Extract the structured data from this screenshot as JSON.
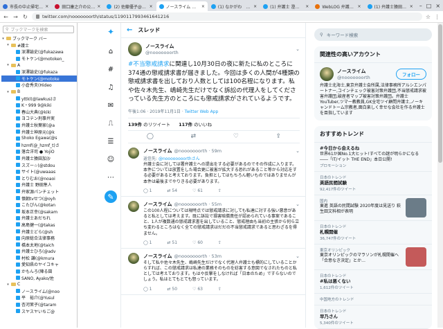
{
  "tabs": [
    {
      "label": "市長の中止帰宅でおれ…",
      "color": "#2e6fd8"
    },
    {
      "label": "田口康之介の公式ブログ",
      "color": "#c8102e"
    },
    {
      "label": "(2) 佐藤優子@ウィ…",
      "color": "#1da1f2"
    },
    {
      "label": "ノースライム さんはTwit…",
      "color": "#1da1f2",
      "active": true
    },
    {
      "label": "(1) なかがわ　もっ…",
      "color": "#1da1f2"
    },
    {
      "label": "(1) 弁護士 澄川 雄…",
      "color": "#1da1f2"
    },
    {
      "label": "WebLOG 弁護士…",
      "color": "#e8710a"
    },
    {
      "label": "(1) 弁護士猿田加…",
      "color": "#1da1f2"
    }
  ],
  "url": "twitter.com/nooooooorth/status/1190117993461641216",
  "sidebar": {
    "search_placeholder": "ブックマークを検索",
    "items": [
      {
        "label": "ブックマーク バー",
        "level": 0,
        "type": "folder",
        "expand": "▾"
      },
      {
        "label": "#護士",
        "level": 1,
        "type": "folder",
        "expand": "▾"
      },
      {
        "label": "深澤諭史(@fukazawa",
        "level": 2,
        "type": "bm"
      },
      {
        "label": "モトケン(@motoken_",
        "level": 2,
        "type": "bm"
      },
      {
        "label": "A",
        "level": 1,
        "type": "folder",
        "expand": "▾"
      },
      {
        "label": "深澤諭史(@fukaza",
        "level": 2,
        "type": "bm"
      },
      {
        "label": "モトケン(@motoke",
        "level": 2,
        "type": "bm",
        "selected": true
      },
      {
        "label": "小倉秀夫(Hideo",
        "level": 2,
        "type": "bm"
      },
      {
        "label": "B",
        "level": 1,
        "type": "folder",
        "expand": "▾"
      },
      {
        "label": "yttkl(@lawkus)さ",
        "level": 2,
        "type": "bm"
      },
      {
        "label": "K・999 9@kiki",
        "level": 2,
        "type": "bm"
      },
      {
        "label": "春山大典(@kiki",
        "level": 2,
        "type": "bm"
      },
      {
        "label": "ヨコテン刑事弁実",
        "level": 2,
        "type": "bm"
      },
      {
        "label": "弁護士秋葉家(@a",
        "level": 2,
        "type": "bm"
      },
      {
        "label": "弁護士神原元(@k",
        "level": 2,
        "type": "bm"
      },
      {
        "label": "Shoko Egawa(@s",
        "level": 2,
        "type": "bm"
      },
      {
        "label": "hzmf(@_hzmf_t)さ",
        "level": 2,
        "type": "bm"
      },
      {
        "label": "落合洋司 ● YojiO",
        "level": 2,
        "type": "bm"
      },
      {
        "label": "弁護士猿田加沙",
        "level": 2,
        "type": "bm"
      },
      {
        "label": "スズー☆(@stdou",
        "level": 2,
        "type": "bm"
      },
      {
        "label": "サイト(@uwaaas",
        "level": 2,
        "type": "bm"
      },
      {
        "label": "とりむお(@noaoi",
        "level": 2,
        "type": "bm"
      },
      {
        "label": "弁護士 野田隼人",
        "level": 2,
        "type": "bm"
      },
      {
        "label": "弁家源パンチェット",
        "level": 2,
        "type": "bm"
      },
      {
        "label": "慎朝tvせつ(@oyh",
        "level": 2,
        "type": "bm"
      },
      {
        "label": "こたぴん(@kotan",
        "level": 2,
        "type": "bm"
      },
      {
        "label": "坂本正幸(@sakam",
        "level": 2,
        "type": "bm"
      },
      {
        "label": "弁護士あだちれ",
        "level": 2,
        "type": "bm"
      },
      {
        "label": "高島健一(@takas",
        "level": 2,
        "type": "bm"
      },
      {
        "label": "弁護士どら(@sh",
        "level": 2,
        "type": "bm"
      },
      {
        "label": "向原総合法律事務",
        "level": 2,
        "type": "bm"
      },
      {
        "label": "橋本太地(@taich",
        "level": 2,
        "type": "bm"
      },
      {
        "label": "弁護士ひろ(@adv",
        "level": 2,
        "type": "bm"
      },
      {
        "label": "村松 謙(@kmura",
        "level": 2,
        "type": "bm"
      },
      {
        "label": "愛知県のヤイコキャ",
        "level": 2,
        "type": "bm"
      },
      {
        "label": "かもんろ(陣る田",
        "level": 2,
        "type": "bm"
      },
      {
        "label": "SANO, Ayako/佐",
        "level": 2,
        "type": "bm"
      },
      {
        "label": "C",
        "level": 1,
        "type": "folder",
        "expand": "▾"
      },
      {
        "label": "ノースライム(@noo",
        "level": 2,
        "type": "bm"
      },
      {
        "label": "平　裕介(@Yusul",
        "level": 2,
        "type": "bm"
      },
      {
        "label": "杏河茉子(@taram",
        "level": 2,
        "type": "bm"
      },
      {
        "label": "スヤスヤいちご@",
        "level": 2,
        "type": "bm"
      }
    ]
  },
  "main": {
    "header": "スレッド",
    "tweet": {
      "name": "ノースライム",
      "handle": "@nooooooorth",
      "hashtag": "#不当懲戒請求",
      "text": "に関連し10月30日の夜に新たに私のところに374通の懲戒請求書が届きました。今回は多くの人間が4種類の懲戒請求書を出しており人数としては100名程になります。私や佐々木先生、嶋崎先生だけでなく訴訟の代理人をしてくださっている先生方のところにも懲戒請求がされているようです。",
      "time": "午後1:06 · 2019年11月1日 · ",
      "source": "Twitter Web App",
      "retweets": "139件",
      "retweets_label": "のリツイート",
      "likes": "117件",
      "likes_label": "のいいね"
    },
    "replies": [
      {
        "name": "ノースライム",
        "handle": "@nooooooorth · 59m",
        "to_prefix": "返信先: ",
        "to": "@noooooooorthさん",
        "text": "弁護士会に対しては署弁護士への提出をする必要があるのでその作成に入ります。本件については放置をした場合更に被害が拡大する恐れがあること等から対応をする必要があると考えております。負担としてはもちろん軽いものではありませんが本件は最後までやりきる必要があります。",
        "reply": "1",
        "rt": "54",
        "like": "61"
      },
      {
        "name": "ノースライム",
        "handle": "@nooooooorth · 55m",
        "to_prefix": "",
        "to": "",
        "text": "この100人程については現時点では懲戒請求に対しても私達に対する強い悪意があると私としては考えます。既に訴訟で損害賠償責任が認められている事案であること、1人が複数通の懲戒請求書を出していること、懲戒理由も当初の主張から何ら立ち変わるところはなく全ての懲戒請求はだだの不当懲戒請求であると思わざるを得ません。",
        "reply": "1",
        "rt": "51",
        "like": "60"
      },
      {
        "name": "ノースライム",
        "handle": "@nooooooorth · 53m",
        "to_prefix": "",
        "to": "",
        "text": "そして私や佐々木先生、嶋崎先生だけでなく代理人弁護士も標的にしていることからすれば、この懲戒請求は私達の業務そのものを妨害する意図でなされたものと私としては考えております。もはや反撃をしなければ「日本のため」ですらないのでしょう。私はとてもとても怒っています。",
        "reply": "1",
        "rt": "50",
        "like": "63"
      }
    ]
  },
  "right": {
    "search_placeholder": "キーワード検索",
    "related_title": "関連性の高いアカウント",
    "account": {
      "name": "ノースライム",
      "handle": "@nooooooorth",
      "follow": "フォロー",
      "bio": "弁護士北海士,東京弁護士会所属,法律事務所アルシエンパートナー,コインチェック被害対策弁護団,不当懲戒請求被害弁護団,破産者マップ被害対策弁護団。弁護士YouTuber,ツマー教教員,GK全宅ツイ顧問弁護士,ノーキャンドトーム宗教者,面白楽しく幸せな会社を作る弁護士を目指しています"
    },
    "trends_title": "おすすめトレンド",
    "trends": [
      {
        "ctx": "",
        "name": "#今日から会えるね",
        "desc": "世界61か国No.1大ヒット!すべての謎が明らかになる――「IT/イット THE END」本日公開!",
        "promo": "プロモーション",
        "count": "",
        "img": ""
      },
      {
        "ctx": "日本のトレンド",
        "name": "英語民間試験",
        "desc": "",
        "promo": "",
        "count": "92,417件のツイート",
        "img": ""
      },
      {
        "ctx": "国内",
        "name": "",
        "desc": "東進 英語の民間試験 2020年度は見送り 萩生田文科相が表明",
        "promo": "",
        "count": "",
        "img": "#6b7c88"
      },
      {
        "ctx": "日本のトレンド",
        "name": "札幌開催",
        "desc": "",
        "promo": "",
        "count": "36,747件のツイート",
        "img": ""
      },
      {
        "ctx": "東京オリンピック",
        "name": "",
        "desc": "東京オリンピックのマラソンが札幌開催へ「合意なき決定」とか…",
        "promo": "",
        "count": "",
        "img": "#c45a5a"
      },
      {
        "ctx": "日本のトレンド",
        "name": "#私は悪くない",
        "desc": "",
        "promo": "",
        "count": "1,612件のツイート",
        "img": ""
      },
      {
        "ctx": "中国地方のトレンド",
        "name": "",
        "desc": "",
        "promo": "",
        "count": "",
        "img": ""
      },
      {
        "ctx": "日本のトレンド",
        "name": "早乃さん",
        "desc": "",
        "promo": "",
        "count": "5,340件のツイート",
        "img": ""
      }
    ]
  }
}
